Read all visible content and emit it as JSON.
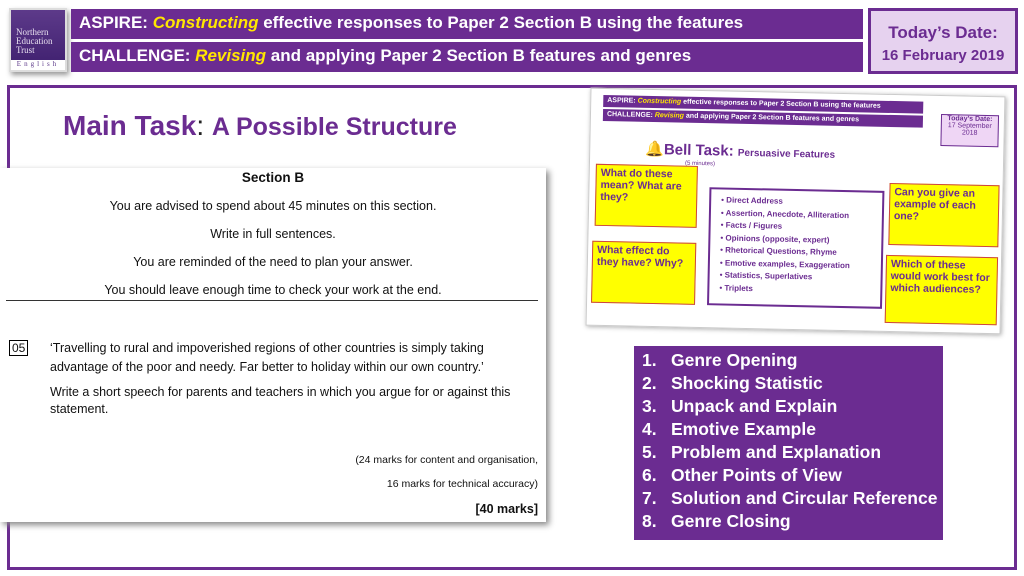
{
  "logo": {
    "lines": [
      "Northern",
      "Education",
      "Trust"
    ],
    "sub": "English"
  },
  "header": {
    "aspire": {
      "prefix": "ASPIRE: ",
      "em": "Constructing",
      "rest": " effective responses to Paper 2 Section B using the features"
    },
    "challenge": {
      "prefix": "CHALLENGE: ",
      "em": "Revising",
      "rest": " and applying Paper 2 Section B features and genres"
    },
    "date_label": "Today’s Date:",
    "date_value": "16 February 2019"
  },
  "title": {
    "main": "Main Task",
    "colon": ":",
    "sub": "A Possible Structure"
  },
  "exam": {
    "heading": "Section B",
    "advice": "You are advised to spend about 45 minutes on this section.",
    "sentences": "Write in full sentences.",
    "plan": "You are reminded of the need to plan your answer.",
    "check": "You should leave enough time to check your work at the end.",
    "qnum": "05",
    "quote": "‘Travelling to rural and impoverished regions of other countries is simply taking advantage of the poor and needy. Far better to holiday within our own country.’",
    "task": "Write a short speech for parents and teachers in which you argue for or against this statement.",
    "marks1": "(24 marks for content and organisation,",
    "marks2": "16 marks for technical accuracy)",
    "total": "[40 marks]"
  },
  "thumbnail": {
    "aspire": "ASPIRE: ",
    "aspire_em": "Constructing",
    "aspire_rest": " effective responses to Paper 2 Section B using the features",
    "challenge": "CHALLENGE: ",
    "challenge_em": "Revising",
    "challenge_rest": " and applying Paper 2 Section B features and genres",
    "date_label": "Today’s Date:",
    "date_value": "17 September 2018",
    "bell": "Bell Task:",
    "bell_sub": "Persuasive Features",
    "time": "(5 minutes)",
    "q1": "What do these mean? What are they?",
    "q2": "What effect do they have? Why?",
    "q3": "Can you give an example of each one?",
    "q4": "Which of these would work best for which audiences?",
    "features": [
      "Direct Address",
      "Assertion, Anecdote, Alliteration",
      "Facts / Figures",
      "Opinions (opposite, expert)",
      "Rhetorical Questions, Rhyme",
      "Emotive examples, Exaggeration",
      "Statistics, Superlatives",
      "Triplets"
    ]
  },
  "structure": [
    {
      "n": "1.",
      "t": "Genre Opening"
    },
    {
      "n": "2.",
      "t": "Shocking Statistic"
    },
    {
      "n": "3.",
      "t": "Unpack and Explain"
    },
    {
      "n": "4.",
      "t": "Emotive Example"
    },
    {
      "n": "5.",
      "t": "Problem and Explanation"
    },
    {
      "n": "6.",
      "t": "Other Points of View"
    },
    {
      "n": "7.",
      "t": "Solution and Circular Reference"
    },
    {
      "n": "8.",
      "t": "Genre Closing"
    }
  ],
  "colors": {
    "purple": "#6b2c91",
    "yellow": "#ffe600"
  }
}
